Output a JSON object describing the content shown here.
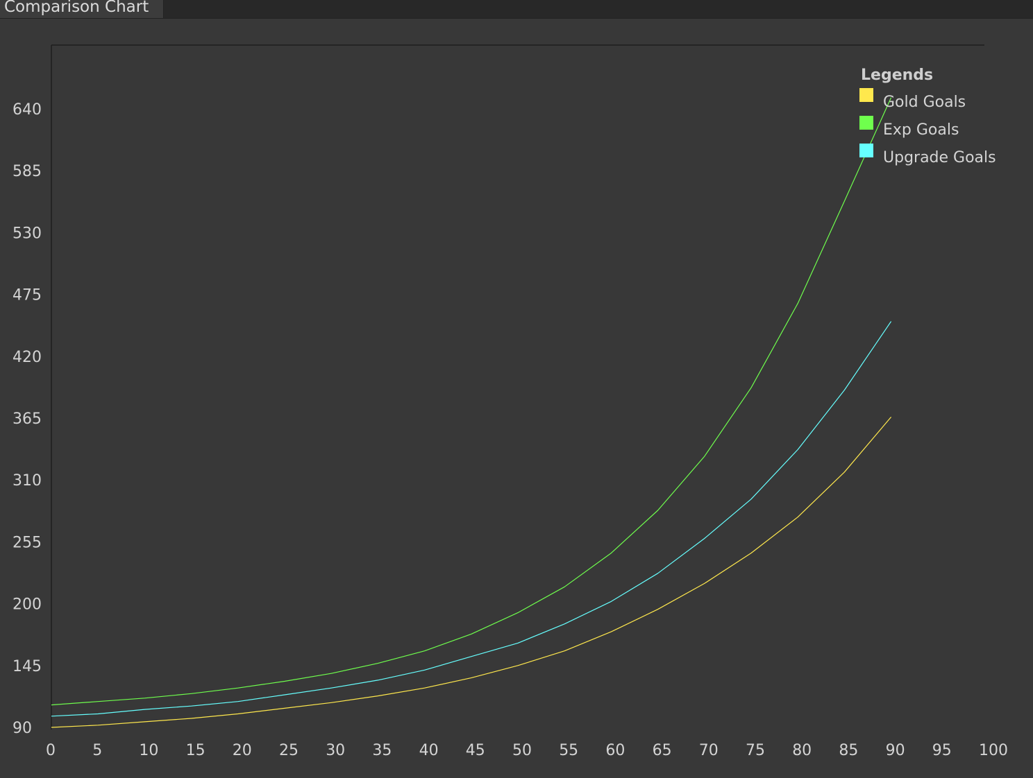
{
  "window": {
    "tab_title": "Comparison Chart"
  },
  "chart_data": {
    "type": "line",
    "title": "",
    "xlabel": "",
    "ylabel": "",
    "xlim": [
      0,
      100
    ],
    "ylim": [
      90,
      695
    ],
    "x_ticks": [
      "0",
      "5",
      "10",
      "15",
      "20",
      "25",
      "30",
      "35",
      "40",
      "45",
      "50",
      "55",
      "60",
      "65",
      "70",
      "75",
      "80",
      "85",
      "90",
      "95",
      "100"
    ],
    "y_ticks": [
      "90",
      "145",
      "200",
      "255",
      "310",
      "365",
      "420",
      "475",
      "530",
      "585",
      "640"
    ],
    "grid": false,
    "legend": {
      "title": "Legends",
      "placement": "top-right"
    },
    "x": [
      0,
      5,
      10,
      15,
      20,
      25,
      30,
      35,
      40,
      45,
      50,
      55,
      60,
      65,
      70,
      75,
      80,
      85,
      90
    ],
    "series": [
      {
        "name": "Gold Goals",
        "color": "#ffe84d",
        "values": [
          90,
          92,
          95,
          98,
          102,
          107,
          112,
          118,
          125,
          134,
          145,
          158,
          175,
          195,
          218,
          245,
          277,
          317,
          366
        ]
      },
      {
        "name": "Exp Goals",
        "color": "#6fff4d",
        "values": [
          110,
          113,
          116,
          120,
          125,
          131,
          138,
          147,
          158,
          173,
          192,
          215,
          245,
          283,
          331,
          392,
          467,
          558,
          650
        ]
      },
      {
        "name": "Upgrade Goals",
        "color": "#66ffff",
        "values": [
          100,
          102,
          106,
          109,
          113,
          119,
          125,
          132,
          141,
          153,
          165,
          182,
          202,
          227,
          258,
          293,
          337,
          390,
          451
        ]
      }
    ]
  }
}
